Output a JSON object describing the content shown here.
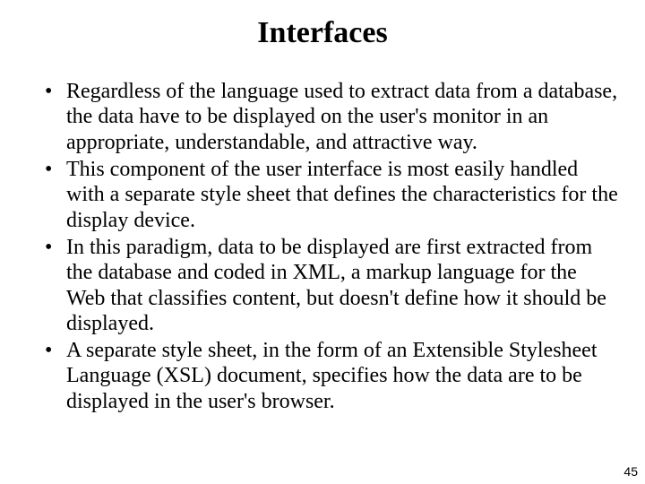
{
  "title": "Interfaces",
  "bullets": [
    "Regardless of the language used to extract data from a database, the data have to be displayed on the user's monitor in an appropriate, understandable, and attractive way.",
    "This component of the user interface is most easily handled with a separate style sheet that defines the characteristics for the display device.",
    "In this paradigm, data to be displayed are first extracted from the database and coded in XML, a markup language for the Web that classifies content, but doesn't define how it should be displayed.",
    "A separate style sheet, in the form of an Extensible Stylesheet Language (XSL) document, specifies how the data are to be displayed in the user's browser."
  ],
  "page_number": "45"
}
